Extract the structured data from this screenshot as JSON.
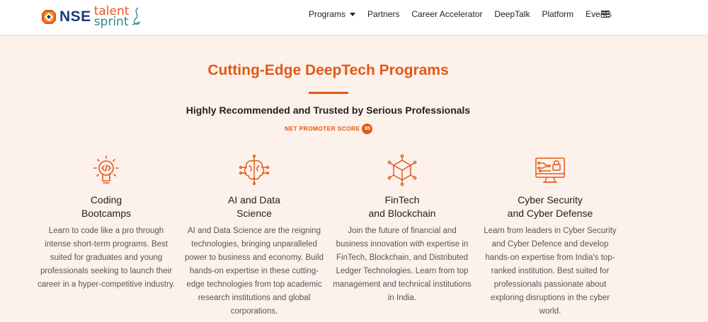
{
  "header": {
    "logo_nse": "NSE",
    "logo_talent": "talent",
    "logo_sprint": "sprint",
    "nav": [
      {
        "label": "Programs",
        "has_dropdown": true
      },
      {
        "label": "Partners"
      },
      {
        "label": "Career Accelerator"
      },
      {
        "label": "DeepTalk"
      },
      {
        "label": "Platform"
      },
      {
        "label": "Events"
      }
    ],
    "menu_icon": "hamburger-menu-icon"
  },
  "hero": {
    "title": "Cutting-Edge DeepTech Programs",
    "subtitle": "Highly Recommended and Trusted by Serious Professionals",
    "nps_label": "NET PROMOTER SCORE",
    "nps_value": "85"
  },
  "programs": [
    {
      "icon": "lightbulb-code-icon",
      "title_line1": "Coding",
      "title_line2": "Bootcamps",
      "desc": "Learn to code like a pro through intense short-term programs. Best suited for graduates and young professionals seeking to launch their career in a hyper-competitive industry."
    },
    {
      "icon": "brain-circuit-icon",
      "title_line1": "AI and Data",
      "title_line2": "Science",
      "desc": "AI and Data Science are the reigning technologies, bringing unparalleled power to business and economy. Build hands-on expertise in these cutting-edge technologies from top academic research institutions and global corporations."
    },
    {
      "icon": "blockchain-cube-icon",
      "title_line1": "FinTech",
      "title_line2": "and Blockchain",
      "desc": "Join the future of financial and business innovation with expertise in FinTech, Blockchain, and Distributed Ledger Technologies. Learn from top management and technical institutions in India."
    },
    {
      "icon": "monitor-lock-icon",
      "title_line1": "Cyber Security",
      "title_line2": "and Cyber Defense",
      "desc": "Learn from leaders in Cyber Security and Cyber Defence and develop hands-on expertise from India's top-ranked institution. Best suited for professionals passionate about exploring disruptions in the cyber world."
    }
  ],
  "colors": {
    "accent": "#e05a18",
    "background": "#fdf1ec",
    "logo_blue": "#1f3a7a",
    "logo_teal": "#2c8b89"
  }
}
